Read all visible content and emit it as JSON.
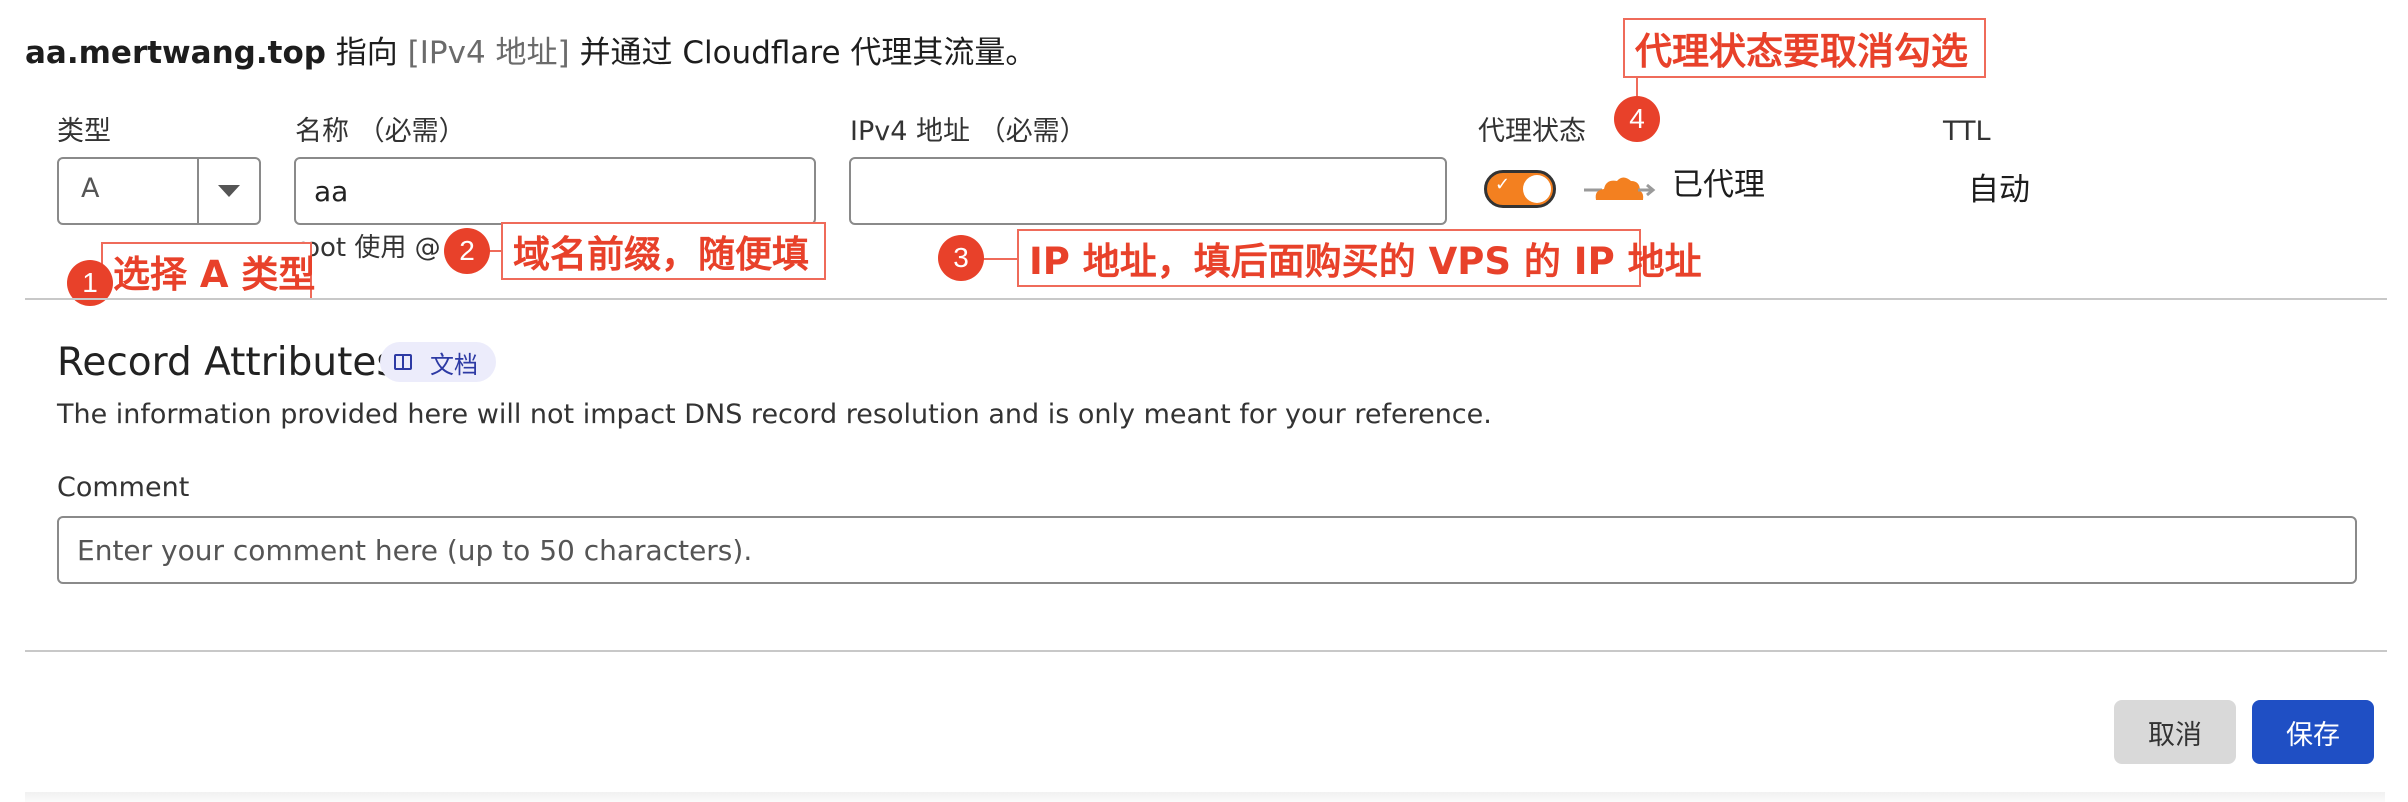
{
  "summary": {
    "domain": "aa.mertwang.top",
    "points_to": " 指向 ",
    "record_tag": "[IPv4 地址]",
    "proxied_via": " 并通过 Cloudflare 代理其流量。"
  },
  "fields": {
    "type_label": "类型",
    "type_value": "A",
    "name_label": "名称 （必需）",
    "name_value": "aa",
    "name_hint": "root 使用 @",
    "ipv4_label": "IPv4 地址 （必需）",
    "ipv4_value": "",
    "proxy_label": "代理状态",
    "proxy_status": "已代理",
    "proxy_enabled": true,
    "ttl_label": "TTL",
    "ttl_value": "自动"
  },
  "annotations": [
    {
      "number": "1",
      "text": "选择 A 类型"
    },
    {
      "number": "2",
      "text": "域名前缀，随便填"
    },
    {
      "number": "3",
      "text": "IP 地址，填后面购买的 VPS 的 IP 地址"
    },
    {
      "number": "4",
      "text": "代理状态要取消勾选"
    }
  ],
  "record_attributes": {
    "title": "Record Attributes",
    "docs_badge": "文档",
    "description": "The information provided here will not impact DNS record resolution and is only meant for your reference.",
    "comment_label": "Comment",
    "comment_placeholder": "Enter your comment here (up to 50 characters).",
    "comment_value": ""
  },
  "buttons": {
    "cancel": "取消",
    "save": "保存"
  },
  "colors": {
    "accent_orange": "#f38020",
    "annotation_red": "#e8412a",
    "primary_blue": "#1f4fc4"
  },
  "icons": {
    "cloud": "cloud-icon",
    "docs": "book-icon",
    "dropdown": "chevron-down-icon"
  }
}
